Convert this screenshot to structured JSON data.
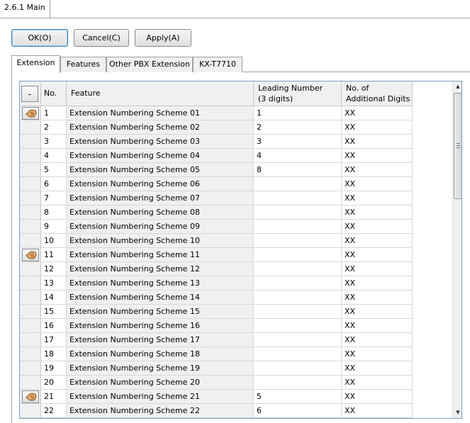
{
  "window": {
    "tab_title": "2.6.1 Main"
  },
  "actions": {
    "ok": "OK(O)",
    "cancel": "Cancel(C)",
    "apply": "Apply(A)"
  },
  "tabs": [
    "Extension",
    "Features",
    "Other PBX Extension",
    "KX-T7710"
  ],
  "active_tab": 0,
  "grid": {
    "collapse_label": "-",
    "headers": {
      "no": "No.",
      "feature": "Feature",
      "leading_1": "Leading Number",
      "leading_2": "(3 digits)",
      "additional_1": "No. of",
      "additional_2": "Additional Digits"
    },
    "rows": [
      {
        "no": "1",
        "feature": "Extension Numbering Scheme 01",
        "leading": "1",
        "additional": "XX",
        "marker": true
      },
      {
        "no": "2",
        "feature": "Extension Numbering Scheme 02",
        "leading": "2",
        "additional": "XX",
        "marker": false
      },
      {
        "no": "3",
        "feature": "Extension Numbering Scheme 03",
        "leading": "3",
        "additional": "XX",
        "marker": false
      },
      {
        "no": "4",
        "feature": "Extension Numbering Scheme 04",
        "leading": "4",
        "additional": "XX",
        "marker": false
      },
      {
        "no": "5",
        "feature": "Extension Numbering Scheme 05",
        "leading": "8",
        "additional": "XX",
        "marker": false
      },
      {
        "no": "6",
        "feature": "Extension Numbering Scheme 06",
        "leading": "",
        "additional": "XX",
        "marker": false
      },
      {
        "no": "7",
        "feature": "Extension Numbering Scheme 07",
        "leading": "",
        "additional": "XX",
        "marker": false
      },
      {
        "no": "8",
        "feature": "Extension Numbering Scheme 08",
        "leading": "",
        "additional": "XX",
        "marker": false
      },
      {
        "no": "9",
        "feature": "Extension Numbering Scheme 09",
        "leading": "",
        "additional": "XX",
        "marker": false
      },
      {
        "no": "10",
        "feature": "Extension Numbering Scheme 10",
        "leading": "",
        "additional": "XX",
        "marker": false
      },
      {
        "no": "11",
        "feature": "Extension Numbering Scheme 11",
        "leading": "",
        "additional": "XX",
        "marker": true
      },
      {
        "no": "12",
        "feature": "Extension Numbering Scheme 12",
        "leading": "",
        "additional": "XX",
        "marker": false
      },
      {
        "no": "13",
        "feature": "Extension Numbering Scheme 13",
        "leading": "",
        "additional": "XX",
        "marker": false
      },
      {
        "no": "14",
        "feature": "Extension Numbering Scheme 14",
        "leading": "",
        "additional": "XX",
        "marker": false
      },
      {
        "no": "15",
        "feature": "Extension Numbering Scheme 15",
        "leading": "",
        "additional": "XX",
        "marker": false
      },
      {
        "no": "16",
        "feature": "Extension Numbering Scheme 16",
        "leading": "",
        "additional": "XX",
        "marker": false
      },
      {
        "no": "17",
        "feature": "Extension Numbering Scheme 17",
        "leading": "",
        "additional": "XX",
        "marker": false
      },
      {
        "no": "18",
        "feature": "Extension Numbering Scheme 18",
        "leading": "",
        "additional": "XX",
        "marker": false
      },
      {
        "no": "19",
        "feature": "Extension Numbering Scheme 19",
        "leading": "",
        "additional": "XX",
        "marker": false
      },
      {
        "no": "20",
        "feature": "Extension Numbering Scheme 20",
        "leading": "",
        "additional": "XX",
        "marker": false
      },
      {
        "no": "21",
        "feature": "Extension Numbering Scheme 21",
        "leading": "5",
        "additional": "XX",
        "marker": true
      },
      {
        "no": "22",
        "feature": "Extension Numbering Scheme 22",
        "leading": "6",
        "additional": "XX",
        "marker": false
      }
    ]
  },
  "icons": {
    "row_marker": "hand-pointer-icon",
    "scroll_up": "arrow-up-icon",
    "scroll_down": "arrow-down-icon"
  }
}
